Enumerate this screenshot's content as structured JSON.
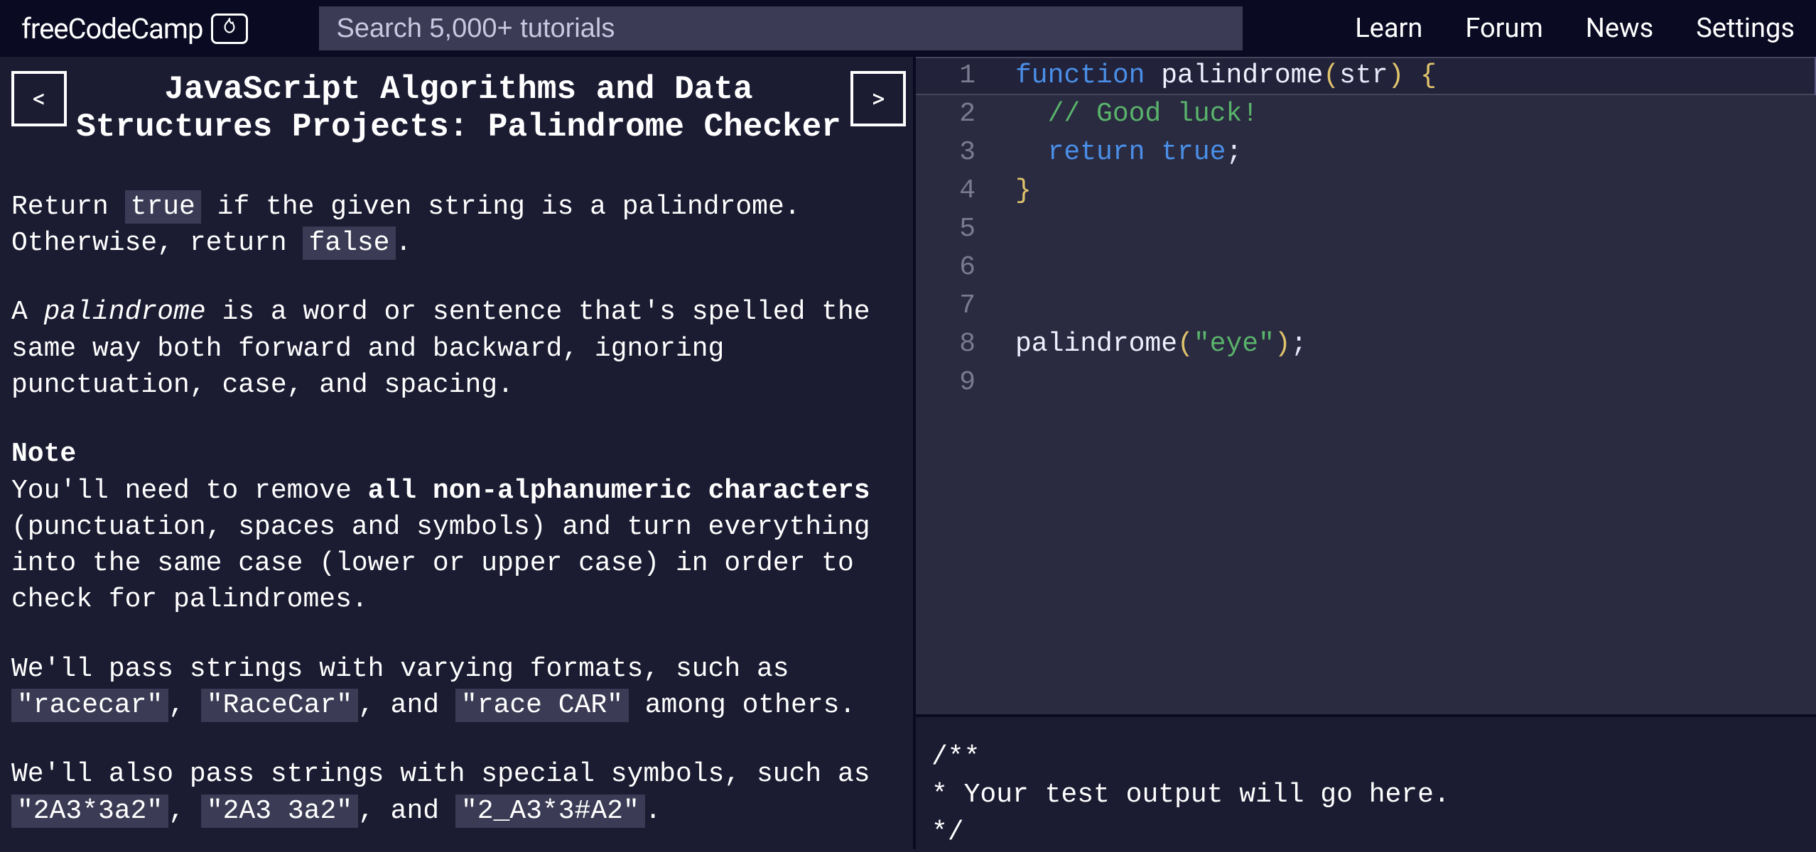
{
  "nav": {
    "logo": "freeCodeCamp",
    "search_placeholder": "Search 5,000+ tutorials",
    "links": [
      "Learn",
      "Forum",
      "News",
      "Settings"
    ]
  },
  "lesson": {
    "prev": "<",
    "next": ">",
    "title": "JavaScript Algorithms and Data Structures Projects: Palindrome Checker",
    "true": "true",
    "false": "false",
    "p1a": "Return ",
    "p1b": " if the given string is a palindrome. Otherwise, return ",
    "p1c": ".",
    "palindrome_word": "palindrome",
    "p2a": "A ",
    "p2b": " is a word or sentence that's spelled the same way both forward and backward, ignoring punctuation, case, and spacing.",
    "note_heading": "Note",
    "p3a": "You'll need to remove ",
    "p3bold": "all non-alphanumeric characters",
    "p3b": " (punctuation, spaces and symbols) and turn everything into the same case (lower or upper case) in order to check for palindromes.",
    "p4a": "We'll pass strings with varying formats, such as ",
    "ex1": "\"racecar\"",
    "ex2": "\"RaceCar\"",
    "ex3": "\"race CAR\"",
    "p4b": ", ",
    "p4c": ", and ",
    "p4d": " among others.",
    "p5a": "We'll also pass strings with special symbols, such as ",
    "ex4": "\"2A3*3a2\"",
    "ex5": "\"2A3 3a2\"",
    "ex6": "\"2_A3*3#A2\"",
    "p5b": ", ",
    "p5c": ", and ",
    "p5d": "."
  },
  "editor": {
    "lines": [
      {
        "n": "1",
        "t": [
          [
            "kw",
            "function "
          ],
          [
            "fn",
            "palindrome"
          ],
          [
            "par",
            "("
          ],
          [
            "id",
            "str"
          ],
          [
            "par",
            ") "
          ],
          [
            "brace",
            "{"
          ]
        ],
        "active": true
      },
      {
        "n": "2",
        "t": [
          [
            "id",
            "  "
          ],
          [
            "com",
            "// Good luck!"
          ]
        ]
      },
      {
        "n": "3",
        "t": [
          [
            "id",
            "  "
          ],
          [
            "kw",
            "return "
          ],
          [
            "bool",
            "true"
          ],
          [
            "id",
            ";"
          ]
        ]
      },
      {
        "n": "4",
        "t": [
          [
            "brace",
            "}"
          ]
        ]
      },
      {
        "n": "5",
        "t": []
      },
      {
        "n": "6",
        "t": []
      },
      {
        "n": "7",
        "t": []
      },
      {
        "n": "8",
        "t": [
          [
            "fn",
            "palindrome"
          ],
          [
            "par",
            "("
          ],
          [
            "str",
            "\"eye\""
          ],
          [
            "par",
            ")"
          ],
          [
            "id",
            ";"
          ]
        ]
      },
      {
        "n": "9",
        "t": []
      }
    ]
  },
  "console": {
    "text": "/**\n* Your test output will go here.\n*/"
  }
}
